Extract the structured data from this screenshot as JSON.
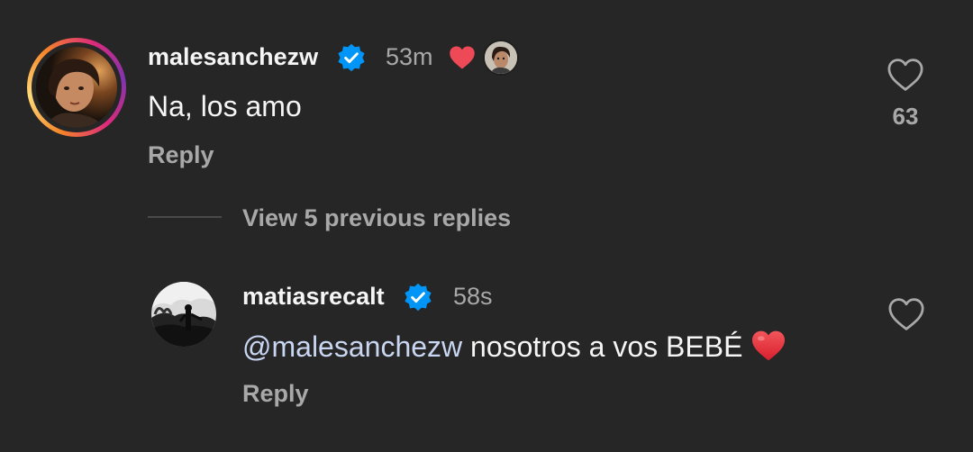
{
  "comment": {
    "username": "malesanchezw",
    "timestamp": "53m",
    "text": "Na, los amo",
    "reply_label": "Reply",
    "like_count": "63"
  },
  "view_replies_label": "View 5 previous replies",
  "reply": {
    "username": "matiasrecalt",
    "timestamp": "58s",
    "mention": "@malesanchezw",
    "text": " nosotros a vos BEBÉ ",
    "reply_label": "Reply"
  },
  "colors": {
    "background": "#262626",
    "verified": "#0095f6",
    "heart": "#ed4956",
    "muted_text": "#a8a8a8",
    "mention": "#c9d6f2"
  }
}
